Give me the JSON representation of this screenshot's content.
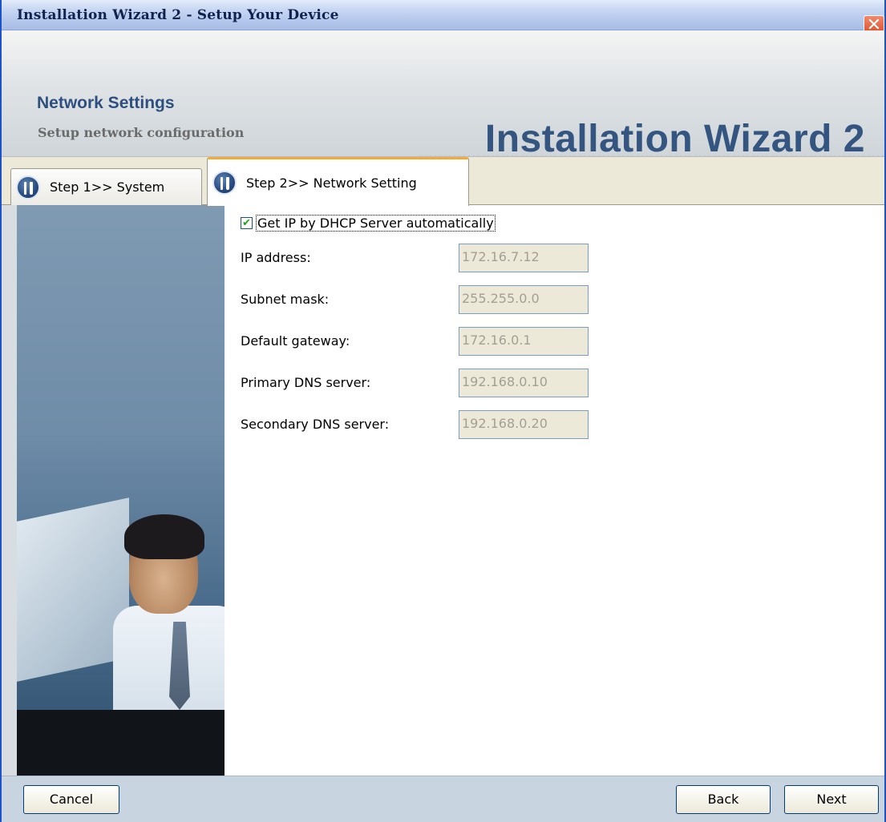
{
  "window": {
    "title": "Installation Wizard 2 - Setup Your Device",
    "close_glyph": "✕"
  },
  "header": {
    "title": "Network Settings",
    "subtitle": "Setup network configuration",
    "brand": "Installation Wizard 2"
  },
  "tabs": [
    {
      "label": "Step 1>> System",
      "icon": "tools-icon",
      "active": false
    },
    {
      "label": "Step 2>> Network Setting",
      "icon": "tools-icon",
      "active": true
    }
  ],
  "form": {
    "dhcp": {
      "label": "Get IP by DHCP Server automatically",
      "checked": true,
      "check_glyph": "✔"
    },
    "fields": [
      {
        "label": "IP address:",
        "value": "172.16.7.12"
      },
      {
        "label": "Subnet mask:",
        "value": "255.255.0.0"
      },
      {
        "label": "Default gateway:",
        "value": "172.16.0.1"
      },
      {
        "label": "Primary DNS server:",
        "value": "192.168.0.10"
      },
      {
        "label": "Secondary DNS server:",
        "value": "192.168.0.20"
      }
    ]
  },
  "buttons": {
    "cancel": "Cancel",
    "back": "Back",
    "next": "Next"
  },
  "colors": {
    "accent_tab": "#f6a935",
    "brand_text": "#34557f",
    "disabled_field_bg": "#ece9d8"
  }
}
